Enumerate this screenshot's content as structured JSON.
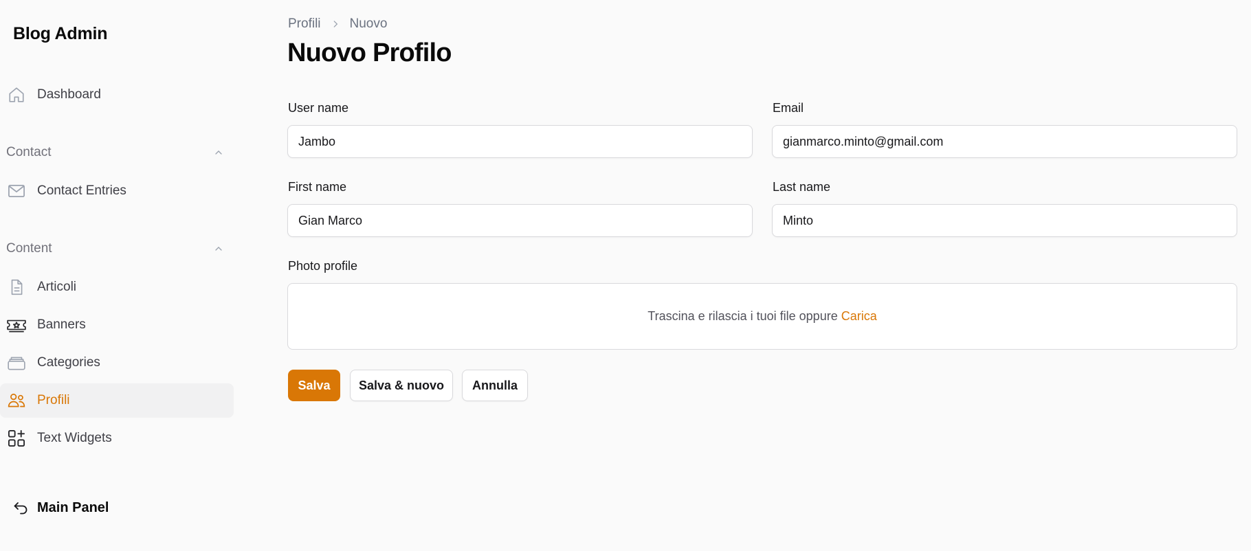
{
  "app": {
    "brand": "Blog Admin"
  },
  "sidebar": {
    "dashboard": {
      "label": "Dashboard",
      "icon": "home-icon"
    },
    "groups": [
      {
        "label": "Contact",
        "expanded": true,
        "items": [
          {
            "label": "Contact Entries",
            "icon": "envelope-icon"
          }
        ]
      },
      {
        "label": "Content",
        "expanded": true,
        "items": [
          {
            "label": "Articoli",
            "icon": "document-icon"
          },
          {
            "label": "Banners",
            "icon": "ticket-star-icon"
          },
          {
            "label": "Categories",
            "icon": "stack-icon"
          },
          {
            "label": "Profili",
            "icon": "users-icon",
            "active": true
          },
          {
            "label": "Text Widgets",
            "icon": "widgets-add-icon"
          }
        ]
      }
    ],
    "main_panel": {
      "label": "Main Panel",
      "icon": "return-arrow-icon"
    }
  },
  "breadcrumb": {
    "parent": "Profili",
    "current": "Nuovo"
  },
  "page": {
    "title": "Nuovo Profilo"
  },
  "form": {
    "username": {
      "label": "User name",
      "value": "Jambo"
    },
    "email": {
      "label": "Email",
      "value": "gianmarco.minto@gmail.com"
    },
    "first_name": {
      "label": "First name",
      "value": "Gian Marco"
    },
    "last_name": {
      "label": "Last name",
      "value": "Minto"
    },
    "photo": {
      "label": "Photo profile",
      "dropzone_text": "Trascina e rilascia i tuoi file oppure",
      "upload_link": "Carica"
    }
  },
  "actions": {
    "save": "Salva",
    "save_new": "Salva & nuovo",
    "cancel": "Annulla"
  },
  "colors": {
    "accent": "#d97706",
    "background": "#fafafa",
    "border": "#d9d9dc"
  }
}
